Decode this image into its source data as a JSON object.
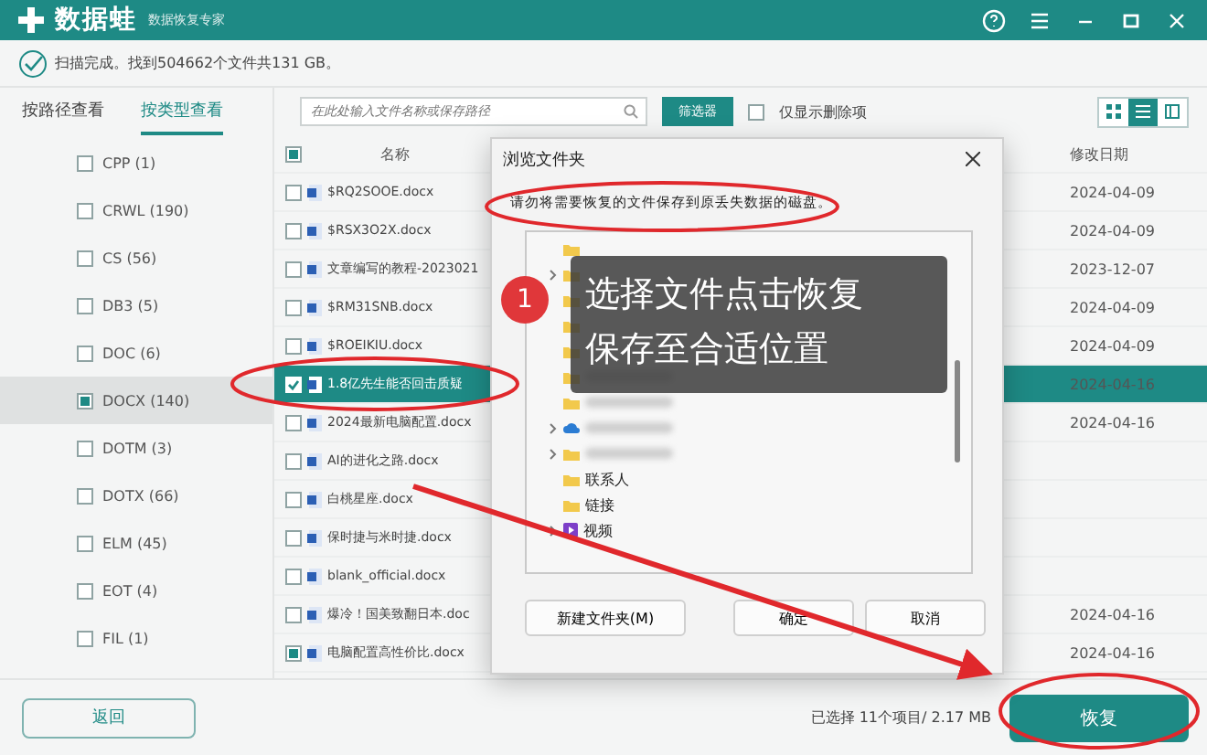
{
  "app": {
    "name": "数据蛙",
    "subtitle": "数据恢复专家"
  },
  "status": {
    "text": "扫描完成。找到504662个文件共131 GB。"
  },
  "view_tabs": [
    {
      "label": "按路径查看",
      "selected": false
    },
    {
      "label": "按类型查看",
      "selected": true
    }
  ],
  "search": {
    "placeholder": "在此处输入文件名称或保存路径"
  },
  "filter_button": "筛选器",
  "deleted_only": {
    "label": "仅显示删除项",
    "checked": false
  },
  "view_modes": [
    {
      "kind": "grid",
      "selected": false
    },
    {
      "kind": "list",
      "selected": true
    },
    {
      "kind": "detail",
      "selected": false
    }
  ],
  "categories": [
    {
      "label": "CPP (1)",
      "checked": false,
      "selected": false
    },
    {
      "label": "CRWL (190)",
      "checked": false,
      "selected": false
    },
    {
      "label": "CS (56)",
      "checked": false,
      "selected": false
    },
    {
      "label": "DB3 (5)",
      "checked": false,
      "selected": false
    },
    {
      "label": "DOC (6)",
      "checked": false,
      "selected": false
    },
    {
      "label": "DOCX (140)",
      "checked": true,
      "selected": true
    },
    {
      "label": "DOTM (3)",
      "checked": false,
      "selected": false
    },
    {
      "label": "DOTX (66)",
      "checked": false,
      "selected": false
    },
    {
      "label": "ELM (45)",
      "checked": false,
      "selected": false
    },
    {
      "label": "EOT (4)",
      "checked": false,
      "selected": false
    },
    {
      "label": "FIL (1)",
      "checked": false,
      "selected": false
    }
  ],
  "table": {
    "all_checked": true,
    "columns": [
      "名称",
      "修改日期"
    ],
    "rows": [
      {
        "name": "$RQ2SOOE.docx",
        "date": "2024-04-09",
        "checked": false,
        "selected": false
      },
      {
        "name": "$RSX3O2X.docx",
        "date": "2024-04-09",
        "checked": false,
        "selected": false
      },
      {
        "name": "文章编写的教程-2023021",
        "date": "2023-12-07",
        "checked": false,
        "selected": false
      },
      {
        "name": "$RM31SNB.docx",
        "date": "2024-04-09",
        "checked": false,
        "selected": false
      },
      {
        "name": "$ROEIKIU.docx",
        "date": "2024-04-09",
        "checked": false,
        "selected": false
      },
      {
        "name": "1.8亿先生能否回击质疑",
        "date": "2024-04-16",
        "checked": true,
        "selected": true
      },
      {
        "name": "2024最新电脑配置.docx",
        "date": "2024-04-16",
        "checked": false,
        "selected": false
      },
      {
        "name": "AI的进化之路.docx",
        "checked": false,
        "selected": false
      },
      {
        "name": "白桃星座.docx",
        "checked": false,
        "selected": false
      },
      {
        "name": "保时捷与米时捷.docx",
        "checked": false,
        "selected": false
      },
      {
        "name": "blank_official.docx",
        "checked": false,
        "selected": false
      },
      {
        "name": "爆冷！国美致翻日本.doc",
        "date": "2024-04-16",
        "checked": false,
        "selected": false
      },
      {
        "name": "电脑配置高性价比.docx",
        "date": "2024-04-16",
        "checked": true,
        "selected": false
      }
    ]
  },
  "dialog": {
    "title": "浏览文件夹",
    "message": "请勿将需要恢复的文件保存到原丢失数据的磁盘。",
    "tree": [
      {
        "kind": "folder",
        "blurred": false,
        "expandable": false
      },
      {
        "kind": "folder",
        "blurred": false,
        "expandable": true
      },
      {
        "kind": "folder",
        "blurred": false,
        "expandable": false
      },
      {
        "kind": "folder",
        "blurred": false,
        "expandable": false
      },
      {
        "kind": "folder",
        "blurred": false,
        "expandable": false
      },
      {
        "kind": "folder",
        "blurred": true,
        "expandable": false
      },
      {
        "kind": "folder",
        "blurred": true,
        "expandable": false
      },
      {
        "kind": "cloud",
        "blurred": true,
        "expandable": true
      },
      {
        "kind": "folder",
        "blurred": true,
        "expandable": true
      },
      {
        "kind": "folder",
        "label": "联系人",
        "expandable": false
      },
      {
        "kind": "folder",
        "label": "链接",
        "expandable": false
      },
      {
        "kind": "video",
        "label": "视频",
        "expandable": true
      }
    ],
    "buttons": [
      "新建文件夹(M)",
      "确定",
      "取消"
    ]
  },
  "callout": {
    "number": "1",
    "lines": [
      "选择文件点击恢复",
      "保存至合适位置"
    ]
  },
  "footer": {
    "back": "返回",
    "summary": "已选择 11个项目/ 2.17 MB",
    "recover": "恢复"
  }
}
